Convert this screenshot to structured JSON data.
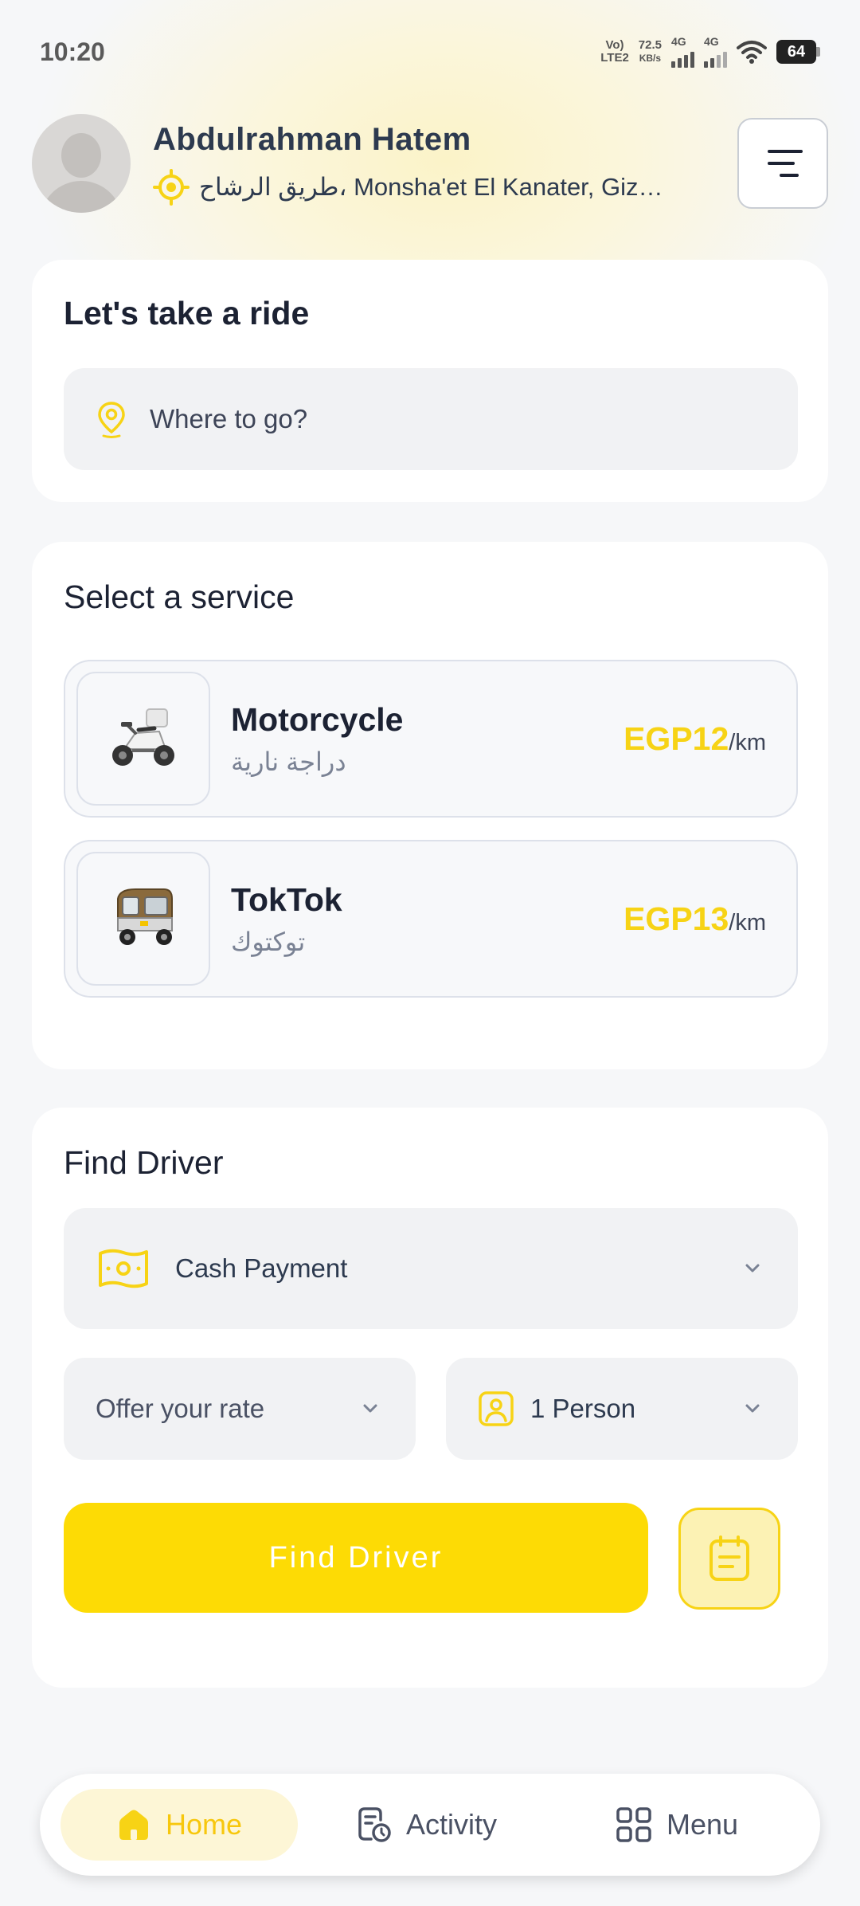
{
  "status_bar": {
    "time": "10:20",
    "volte_top": "Vo)",
    "volte_bottom": "LTE2",
    "speed_value": "72.5",
    "speed_unit": "KB/s",
    "net1": "4G",
    "net2": "4G",
    "battery": "64"
  },
  "header": {
    "user_name": "Abdulrahman Hatem",
    "location": "طريق الرشاح، Monsha'et El Kanater, Giza ..."
  },
  "ride_card": {
    "title": "Let's take a ride",
    "search_placeholder": "Where to go?"
  },
  "service_card": {
    "title": "Select a service",
    "services": [
      {
        "name": "Motorcycle",
        "name_ar": "دراجة نارية",
        "price": "EGP12",
        "unit": "/km",
        "icon": "motorcycle-icon"
      },
      {
        "name": "TokTok",
        "name_ar": "توكتوك",
        "price": "EGP13",
        "unit": "/km",
        "icon": "tuktuk-icon"
      }
    ]
  },
  "driver_card": {
    "title": "Find Driver",
    "payment_label": "Cash Payment",
    "rate_label": "Offer your rate",
    "persons_label": "1 Person",
    "find_button": "Find Driver"
  },
  "bottom_nav": {
    "items": [
      {
        "label": "Home",
        "icon": "home-icon",
        "active": true
      },
      {
        "label": "Activity",
        "icon": "activity-icon",
        "active": false
      },
      {
        "label": "Menu",
        "icon": "grid-menu-icon",
        "active": false
      }
    ]
  },
  "colors": {
    "accent": "#fddb05",
    "price": "#f7d315",
    "text_dark": "#1c2233",
    "card_bg": "#ffffff",
    "page_bg": "#f6f7f9"
  }
}
